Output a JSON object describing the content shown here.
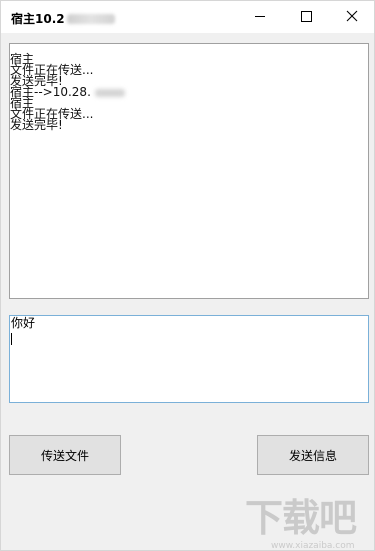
{
  "window": {
    "title": "宿主10.2"
  },
  "chat_log": {
    "lines": [
      "宿主",
      "文件正在传送...",
      "发送完毕!",
      "宿主-->10.28.",
      "宿主",
      "文件正在传送...",
      "发送完毕!"
    ]
  },
  "message_input": {
    "value": "你好"
  },
  "buttons": {
    "send_file": "传送文件",
    "send_message": "发送信息"
  },
  "watermark": {
    "text": "下载吧",
    "url": "www.xiazaiba.com"
  }
}
